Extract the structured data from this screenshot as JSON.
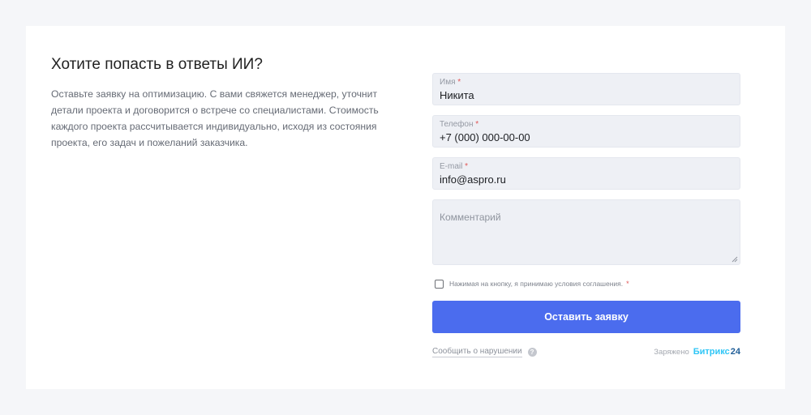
{
  "intro": {
    "title": "Хотите попасть в ответы ИИ?",
    "description": "Оставьте заявку на оптимизацию. С вами свяжется менеджер, уточнит детали проекта и договорится о встрече со специалистами. Стоимость каждого проекта рассчитывается индивидуально, исходя из состояния проекта, его задач и пожеланий заказчика."
  },
  "form": {
    "required_mark": "*",
    "name": {
      "label": "Имя",
      "value": "Никита"
    },
    "phone": {
      "label": "Телефон",
      "value": "+7 (000) 000-00-00"
    },
    "email": {
      "label": "E-mail",
      "value": "info@aspro.ru"
    },
    "comment": {
      "placeholder": "Комментарий"
    },
    "consent": {
      "text": "Нажимая на кнопку, я принимаю условия соглашения.",
      "checked": false
    },
    "submit_label": "Оставить заявку"
  },
  "footer": {
    "report_label": "Сообщить о нарушении",
    "help_glyph": "?",
    "powered_by": "Заряжено",
    "brand_name": "Битрикс",
    "brand_number": "24",
    "brand_colors": {
      "name": "#2fc6f6",
      "number": "#215f98"
    },
    "accent_color": "#4b6cee"
  }
}
